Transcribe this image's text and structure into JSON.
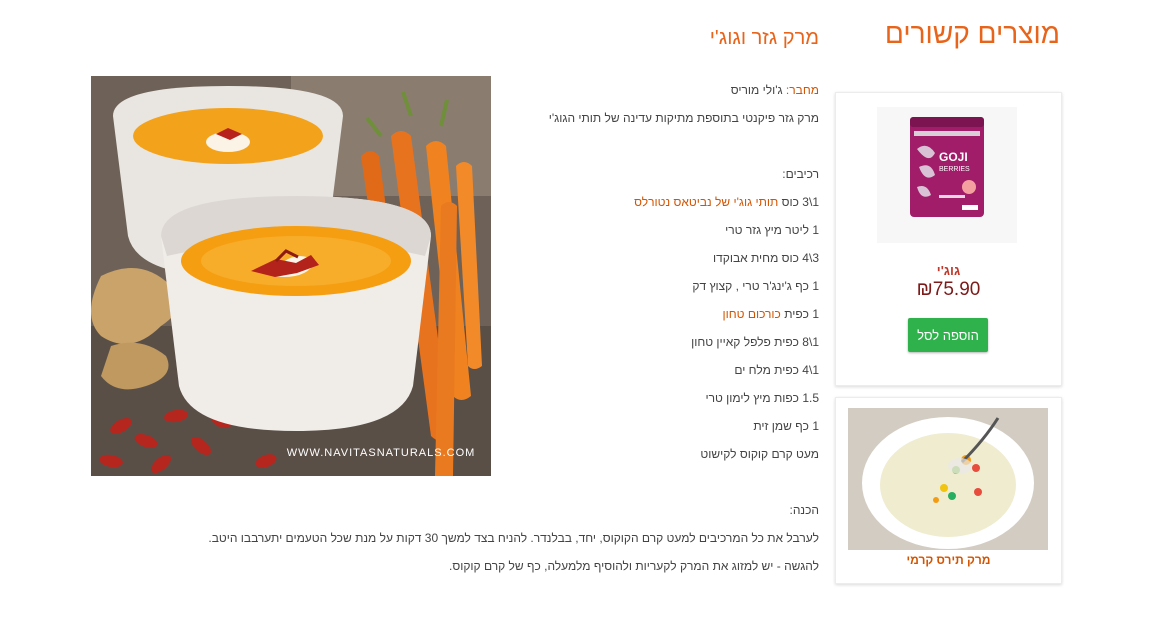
{
  "related": {
    "title": "מוצרים קשורים",
    "product": {
      "name": "גוג'י",
      "price": "₪75.90",
      "button_label": "הוספה לסל",
      "package_brand": "GOJI",
      "package_subtitle": "BERRIES"
    },
    "recipe_card": {
      "name": "מרק תירס קרמי"
    }
  },
  "recipe": {
    "title": "מרק גזר וגוג'י",
    "author_label": "מחבר:",
    "author_name": "ג'ולי מוריס",
    "description": "מרק גזר פיקנטי בתוספת מתיקות עדינה של תותי הגוג'י",
    "ingredients_label": "רכיבים:",
    "ingredients": [
      {
        "text": "1\\3 כוס",
        "link": "תותי גוג'י של נביטאס נטורלס"
      },
      {
        "text": "1 ליטר מיץ גזר טרי"
      },
      {
        "text": "3\\4 כוס מחית אבוקדו"
      },
      {
        "text": "1 כף ג'ינג'ר טרי , קצוץ דק"
      },
      {
        "text": "1 כפית",
        "link": "כורכום טחון"
      },
      {
        "text": "1\\8 כפית פלפל קאיין טחון"
      },
      {
        "text": "1\\4 כפית מלח ים"
      },
      {
        "text": "1.5 כפות מיץ לימון טרי"
      },
      {
        "text": "1 כף שמן זית"
      },
      {
        "text": "מעט קרם קוקוס לקישוט"
      }
    ],
    "prep_label": "הכנה:",
    "prep_steps": [
      "לערבל את כל המרכיבים למעט קרם הקוקוס, יחד, בבלנדר. להניח בצד למשך 30 דקות על מנת שכל הטעמים יתערבבו היטב.",
      "להגשה - יש למזוג את המרק לקעריות ולהוסיף מלמעלה, כף של קרם קוקוס."
    ],
    "photo_watermark": "WWW.NAVITASNATURALS.COM"
  },
  "colors": {
    "accent": "#e8641b",
    "price": "#7d1a1a",
    "button": "#2fb24c"
  }
}
